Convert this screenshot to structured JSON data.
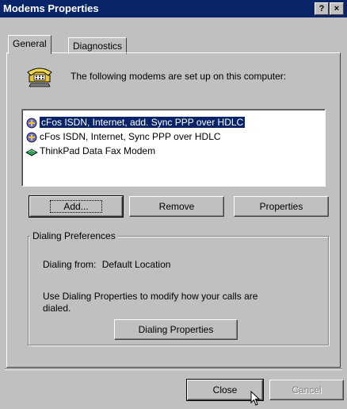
{
  "window": {
    "title": "Modems Properties",
    "help_label": "?",
    "close_label": "×"
  },
  "tabs": [
    {
      "label": "General"
    },
    {
      "label": "Diagnostics"
    }
  ],
  "header_text": "The following modems are set up on this computer:",
  "modems": [
    {
      "label": "cFos ISDN, Internet, add. Sync PPP over HDLC",
      "icon": "isdn-icon",
      "selected": true
    },
    {
      "label": "cFos ISDN, Internet, Sync PPP over HDLC",
      "icon": "isdn-icon",
      "selected": false
    },
    {
      "label": "ThinkPad Data Fax Modem",
      "icon": "modem-icon",
      "selected": false
    }
  ],
  "buttons": {
    "add": "Add...",
    "remove": "Remove",
    "properties": "Properties",
    "dialing_properties": "Dialing Properties",
    "close": "Close",
    "cancel": "Cancel"
  },
  "dialing_preferences": {
    "legend": "Dialing Preferences",
    "dialing_from_label": "Dialing from:",
    "dialing_from_value": "Default Location",
    "info_text": "Use Dialing Properties to modify how your calls are dialed."
  }
}
